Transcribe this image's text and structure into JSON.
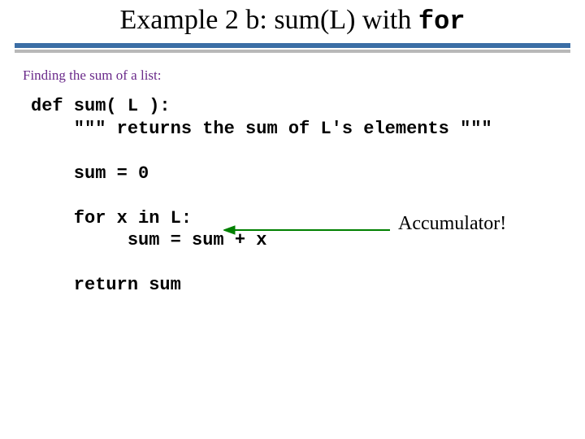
{
  "title": {
    "prefix": "Example 2 b: sum(L) with ",
    "mono": "for"
  },
  "subhead": "Finding the sum of a list:",
  "code": "def sum( L ):\n    \"\"\" returns the sum of L's elements \"\"\"\n\n    sum = 0\n\n    for x in L:\n         sum = sum + x\n\n    return sum",
  "annotation": "Accumulator!"
}
